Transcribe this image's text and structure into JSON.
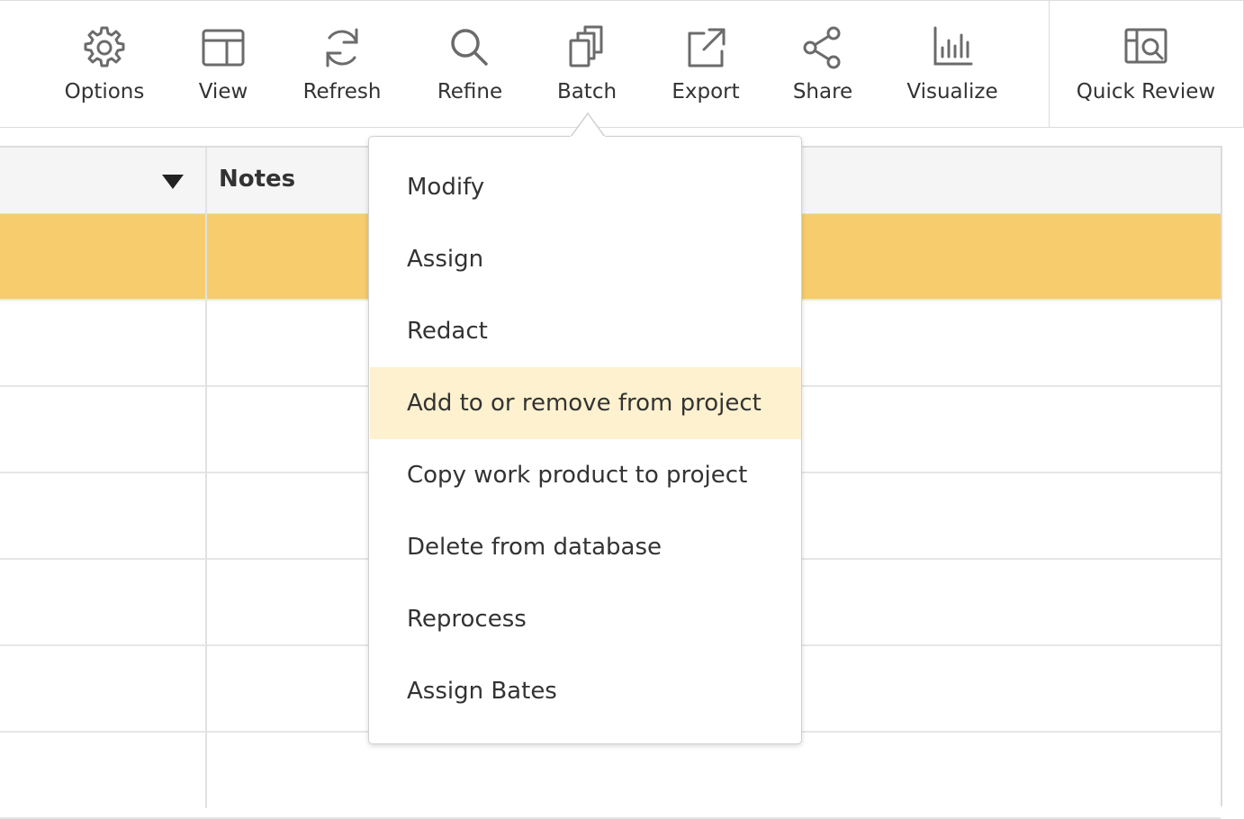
{
  "toolbar": {
    "items": [
      {
        "label": "Options",
        "icon": "gear-icon"
      },
      {
        "label": "View",
        "icon": "layout-icon"
      },
      {
        "label": "Refresh",
        "icon": "refresh-icon"
      },
      {
        "label": "Refine",
        "icon": "search-icon"
      },
      {
        "label": "Batch",
        "icon": "copy-icon"
      },
      {
        "label": "Export",
        "icon": "export-icon"
      },
      {
        "label": "Share",
        "icon": "share-icon"
      },
      {
        "label": "Visualize",
        "icon": "bar-chart-icon"
      },
      {
        "label": "Quick Review",
        "icon": "quick-review-icon"
      }
    ]
  },
  "grid": {
    "notes_header": "Notes"
  },
  "batch_menu": {
    "items": [
      "Modify",
      "Assign",
      "Redact",
      "Add to or remove from project",
      "Copy work product to project",
      "Delete from database",
      "Reprocess",
      "Assign Bates"
    ],
    "highlighted_index": 3
  },
  "colors": {
    "selected_row": "#f6cc6c",
    "menu_hover": "#fdf1cf",
    "header_bg": "#f4f5f4",
    "icon_gray": "#6b6b6b"
  }
}
